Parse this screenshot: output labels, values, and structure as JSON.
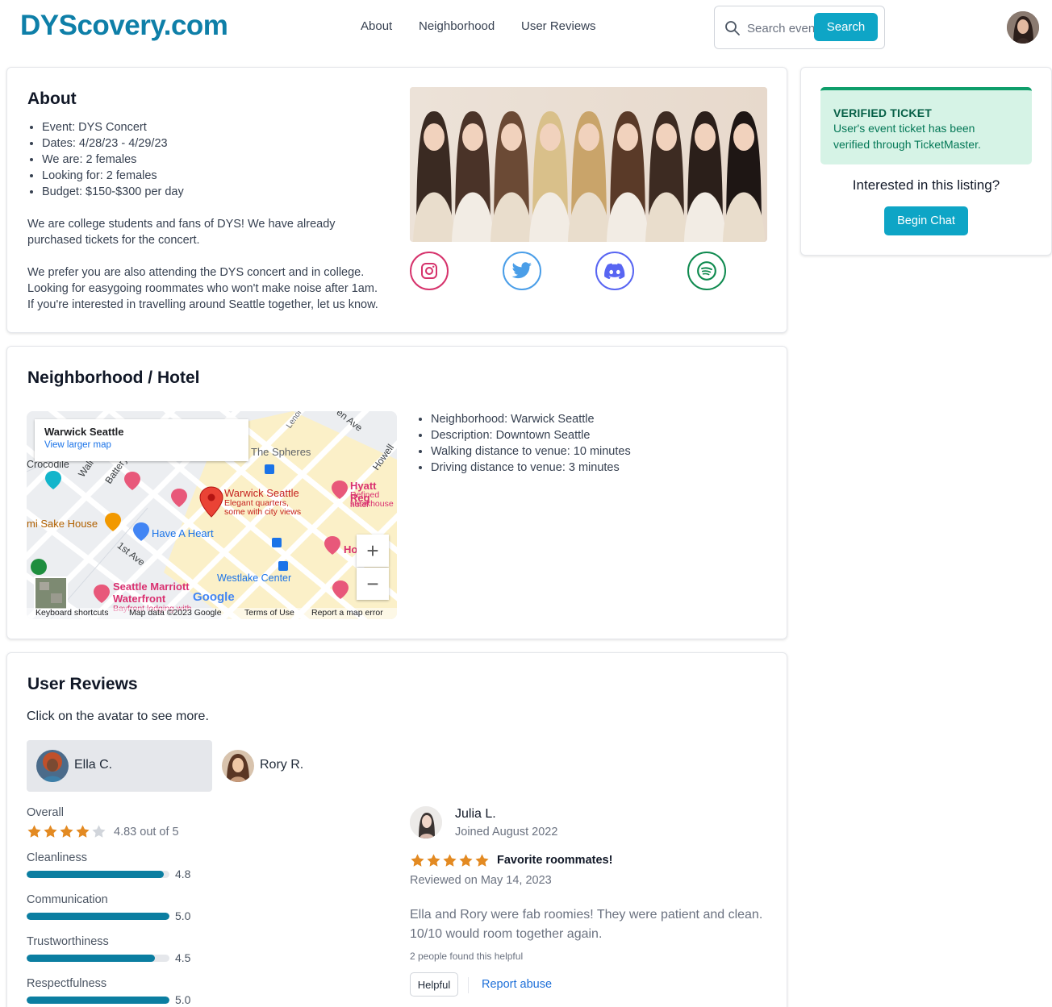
{
  "header": {
    "logo": "DYScovery.com",
    "nav": [
      "About",
      "Neighborhood",
      "User Reviews"
    ],
    "search_placeholder": "Search events",
    "search_button": "Search"
  },
  "about": {
    "title": "About",
    "details": [
      "Event: DYS Concert",
      "Dates: 4/28/23 - 4/29/23",
      "We are: 2 females",
      "Looking for: 2 females",
      "Budget: $150-$300 per day"
    ],
    "paragraph1": "We are college students and fans of DYS! We have already purchased tickets for the concert.",
    "paragraph2_lines": [
      "We prefer you are also attending the DYS concert and in college.",
      "Looking for easygoing roommates who won't make noise after 1am.",
      "If you're interested in travelling around Seattle together, let us know."
    ],
    "social": [
      {
        "icon": "instagram-icon",
        "color": "#d6336c"
      },
      {
        "icon": "twitter-icon",
        "color": "#4a9ee8"
      },
      {
        "icon": "discord-icon",
        "color": "#5865f2"
      },
      {
        "icon": "spotify-icon",
        "color": "#0f8a4f"
      }
    ]
  },
  "ticket": {
    "badge_title": "VERIFIED TICKET",
    "badge_line1": "User's event ticket has been",
    "badge_line2": "verified through TicketMaster.",
    "question": "Interested in this listing?",
    "chat_button": "Begin Chat"
  },
  "neighborhood": {
    "title": "Neighborhood / Hotel",
    "map": {
      "place": "Warwick Seattle",
      "larger_map_link": "View larger map",
      "zoom_in": "+",
      "zoom_out": "−",
      "footer": [
        "Keyboard shortcuts",
        "Map data ©2023 Google",
        "Terms of Use",
        "Report a map error"
      ],
      "brand": "Google",
      "labels": {
        "spheres": "The Spheres",
        "crocodile": "Crocodile",
        "warwick": "Warwick Seattle",
        "warwick_desc1": "Elegant quarters,",
        "warwick_desc2": "some with city views",
        "hyatt": "Hyatt Reg",
        "hyatt_desc1": "Refined hotel",
        "hyatt_desc2": "steakhouse",
        "sake": "mi Sake House",
        "heart": "Have A Heart",
        "westlake": "Westlake Center",
        "marriott1": "Seattle Marriott",
        "marriott2": "Waterfront",
        "marriott3": "Bayfront lodging with",
        "ave1": "1st Ave",
        "battery": "Battery",
        "wall": "Wall",
        "howell": "Howell",
        "lenora": "Lenora",
        "enave": "en Ave",
        "hotelcut": "Ho"
      }
    },
    "details": [
      "Neighborhood: Warwick Seattle",
      "Description: Downtown Seattle",
      "Walking distance to venue: 10 minutes",
      "Driving distance to venue: 3 minutes"
    ]
  },
  "reviews": {
    "title": "User Reviews",
    "subtitle": "Click on the avatar to see more.",
    "users": [
      "Ella C.",
      "Rory R."
    ],
    "overall_label": "Overall",
    "overall_text": "4.83 out of 5",
    "overall_stars": 4,
    "metrics": [
      {
        "label": "Cleanliness",
        "value": "4.8",
        "fraction": 0.96
      },
      {
        "label": "Communication",
        "value": "5.0",
        "fraction": 1.0
      },
      {
        "label": "Trustworthiness",
        "value": "4.5",
        "fraction": 0.9
      },
      {
        "label": "Respectfulness",
        "value": "5.0",
        "fraction": 1.0
      }
    ],
    "review": {
      "name": "Julia L.",
      "joined": "Joined August 2022",
      "stars": 5,
      "title": "Favorite roommates!",
      "date": "Reviewed on May 14, 2023",
      "body_line1": "Ella and Rory were fab roomies! They were patient and clean.",
      "body_line2": "10/10 would room together again.",
      "helpful_count": "2 people found this helpful",
      "helpful_button": "Helpful",
      "report_link": "Report abuse"
    }
  },
  "colors": {
    "accent": "#0ea5c6",
    "logo": "#0e7fa8",
    "bar": "#0b7ea1",
    "star": "#e38a22",
    "verified_bg": "#d6f3e6",
    "verified_border": "#0f9e6b"
  }
}
